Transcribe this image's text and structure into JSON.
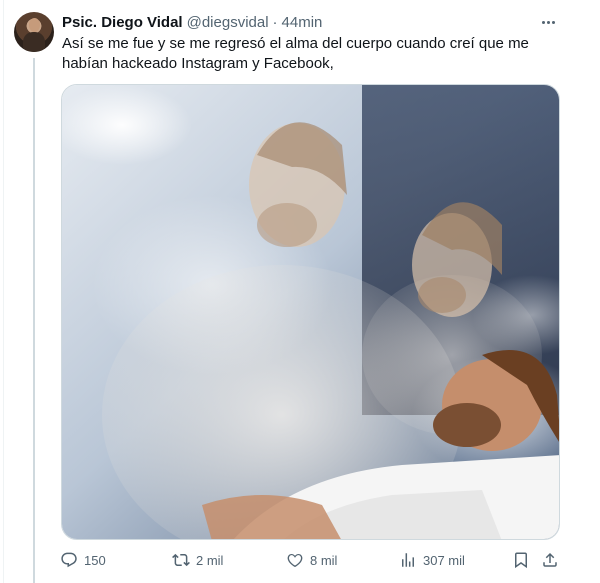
{
  "tweet": {
    "author_name": "Psic. Diego Vidal",
    "author_handle": "@diegsvidal",
    "separator": "·",
    "time": "44min",
    "text_line1": "Así se me fue y se me regresó el alma del cuerpo cuando creí que me",
    "text_line2": "habían hackeado Instagram y Facebook,"
  },
  "actions": {
    "replies": "150",
    "retweets": "2 mil",
    "likes": "8 mil",
    "views": "307 mil"
  },
  "icons": [
    "more-icon",
    "reply-icon",
    "retweet-icon",
    "like-icon",
    "views-icon",
    "bookmark-icon",
    "share-icon"
  ],
  "colors": {
    "text": "#0f1419",
    "muted": "#536471",
    "border": "#cfd9de"
  }
}
